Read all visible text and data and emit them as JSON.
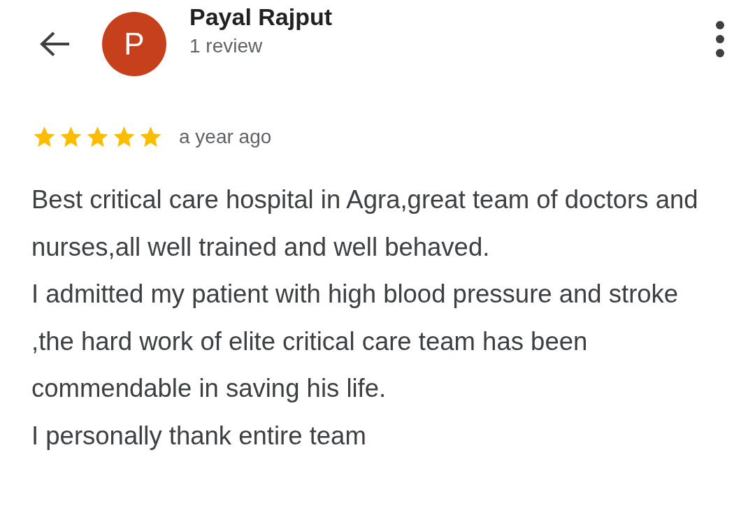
{
  "header": {
    "avatar_letter": "P",
    "name": "Payal Rajput",
    "subtitle": "1 review"
  },
  "review": {
    "stars": 5,
    "time": "a year ago",
    "paragraphs": [
      "Best critical care hospital in Agra,great team of doctors and nurses,all well trained and well behaved.",
      "I admitted my patient with high blood pressure and stroke ,the hard work of elite critical care team has been commendable in saving his life.",
      "I personally thank entire team"
    ]
  }
}
